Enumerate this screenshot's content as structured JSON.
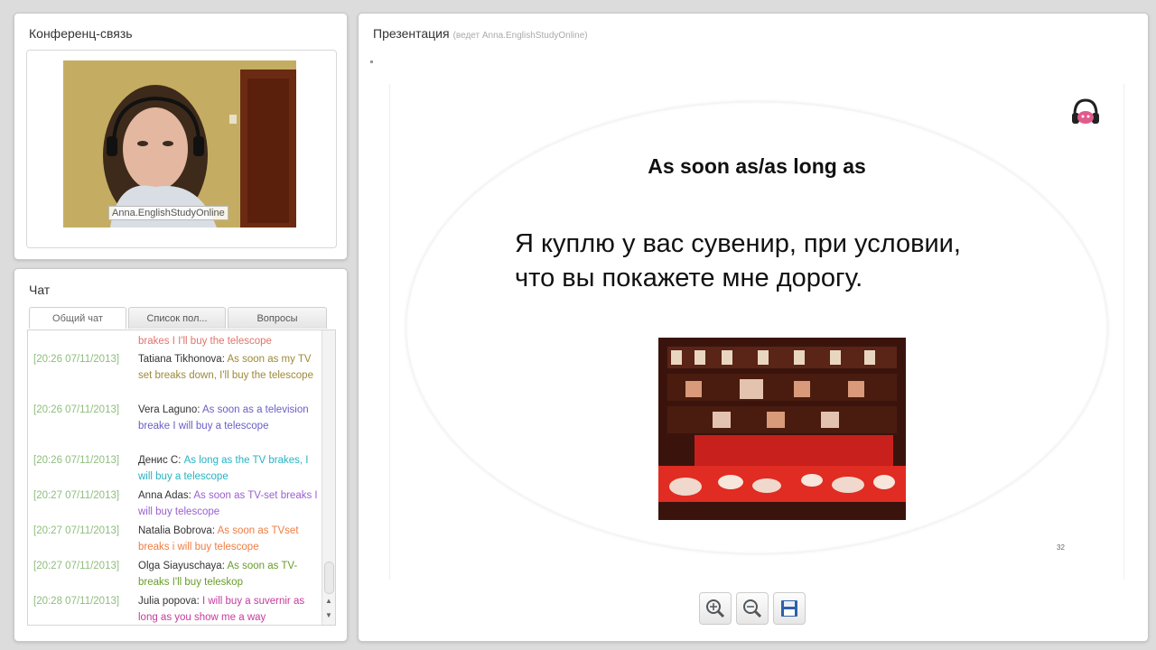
{
  "conference": {
    "title": "Конференц-связь",
    "video_label": "Anna.EnglishStudyOnline"
  },
  "chat": {
    "title": "Чат",
    "tabs": [
      "Общий чат",
      "Список пол...",
      "Вопросы"
    ],
    "messages": [
      {
        "timestamp": "",
        "author": "",
        "text": "brakes I  I'll buy the telescope",
        "color": "#e0746a"
      },
      {
        "timestamp": "[20:26 07/11/2013]",
        "author": "Tatiana Tikhonova: ",
        "text": "As soon as my TV set breaks down, I'll  buy the telescope",
        "color": "#9d8a3a"
      },
      {
        "timestamp": "[20:26 07/11/2013]",
        "author": "Vera Laguno: ",
        "text": "As soon as   a television breake I will buy  a telescope",
        "color": "#6a5ec7"
      },
      {
        "timestamp": "[20:26 07/11/2013]",
        "author": "Денис С: ",
        "text": "As long as the TV brakes, I will buy a telescope",
        "color": "#27b3c2"
      },
      {
        "timestamp": "[20:27 07/11/2013]",
        "author": "Anna Adas: ",
        "text": "As soon as TV-set breaks I will  buy telescope",
        "color": "#9a5fd1"
      },
      {
        "timestamp": "[20:27 07/11/2013]",
        "author": "Natalia Bobrova: ",
        "text": "As soon as TVset breaks i will buy telescope",
        "color": "#ef7d43"
      },
      {
        "timestamp": "[20:27 07/11/2013]",
        "author": "Olga Siayuschaya: ",
        "text": "As soon as TV-breaks  I'll buy teleskop",
        "color": "#6a9c2b"
      },
      {
        "timestamp": "[20:28 07/11/2013]",
        "author": "Julia popova: ",
        "text": "I will buy a suvernir as long as you show me a way",
        "color": "#c73a9c"
      }
    ]
  },
  "presentation": {
    "title": "Презентация",
    "host": "(ведет Anna.EnglishStudyOnline)",
    "slide": {
      "title": "As soon as/as long as",
      "text": "Я куплю у вас сувенир, при условии, что вы покажете мне дорогу.",
      "number": "32"
    },
    "toolbar": {
      "zoom_in_icon": "zoom-in-icon",
      "zoom_out_icon": "zoom-out-icon",
      "save_icon": "floppy-disk-icon"
    }
  }
}
